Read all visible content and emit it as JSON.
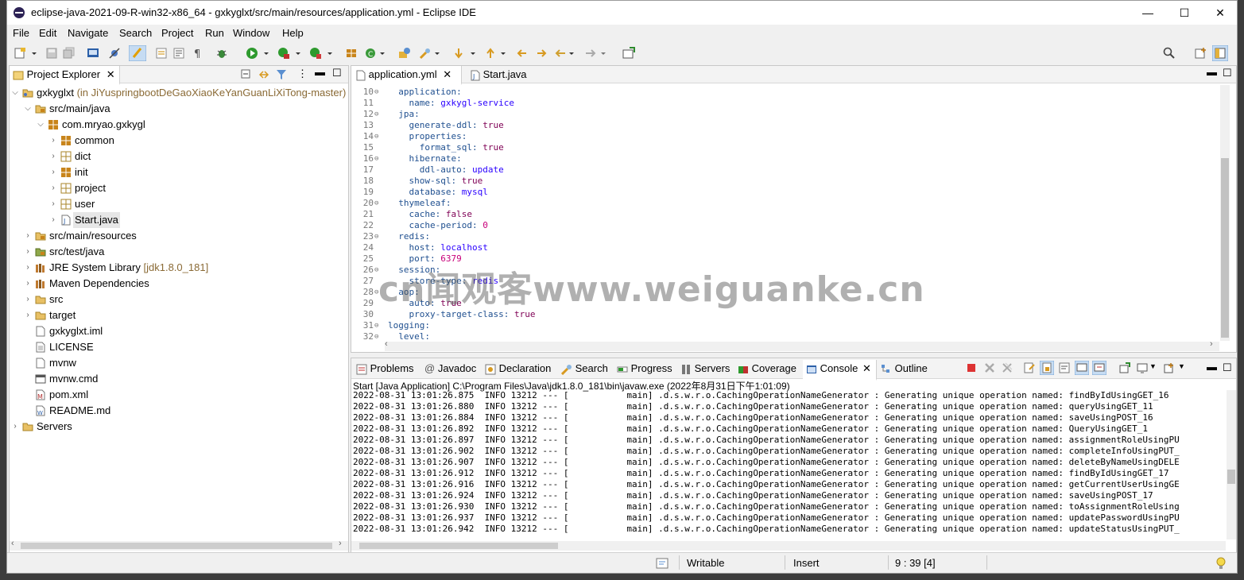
{
  "window": {
    "title": "eclipse-java-2021-09-R-win32-x86_64 - gxkyglxt/src/main/resources/application.yml - Eclipse IDE",
    "controls": {
      "minimize": "—",
      "maximize": "☐",
      "close": "✕"
    }
  },
  "menu": [
    "File",
    "Edit",
    "Navigate",
    "Search",
    "Project",
    "Run",
    "Window",
    "Help"
  ],
  "project_explorer": {
    "title": "Project Explorer",
    "project": {
      "name": "gxkyglxt",
      "decoration": "(in JiYuspringbootDeGaoXiaoKeYanGuanLiXiTong-master)"
    },
    "items": [
      {
        "label": "src/main/java",
        "decoration": ""
      },
      {
        "label": "com.mryao.gxkygl",
        "decoration": ""
      },
      {
        "label": "common",
        "decoration": ""
      },
      {
        "label": "dict",
        "decoration": ""
      },
      {
        "label": "init",
        "decoration": ""
      },
      {
        "label": "project",
        "decoration": ""
      },
      {
        "label": "user",
        "decoration": ""
      },
      {
        "label": "Start.java",
        "decoration": ""
      },
      {
        "label": "src/main/resources",
        "decoration": ""
      },
      {
        "label": "src/test/java",
        "decoration": ""
      },
      {
        "label": "JRE System Library",
        "decoration": "[jdk1.8.0_181]"
      },
      {
        "label": "Maven Dependencies",
        "decoration": ""
      },
      {
        "label": "src",
        "decoration": ""
      },
      {
        "label": "target",
        "decoration": ""
      },
      {
        "label": "gxkyglxt.iml",
        "decoration": ""
      },
      {
        "label": "LICENSE",
        "decoration": ""
      },
      {
        "label": "mvnw",
        "decoration": ""
      },
      {
        "label": "mvnw.cmd",
        "decoration": ""
      },
      {
        "label": "pom.xml",
        "decoration": ""
      },
      {
        "label": "README.md",
        "decoration": ""
      },
      {
        "label": "Servers",
        "decoration": ""
      }
    ]
  },
  "editor": {
    "tabs": [
      {
        "label": "application.yml",
        "close": "✕"
      },
      {
        "label": "Start.java",
        "close": ""
      }
    ],
    "lines": [
      {
        "num": "10",
        "fold": "⊖",
        "indent": "  ",
        "key": "application:",
        "value": "",
        "vtype": ""
      },
      {
        "num": "11",
        "fold": "",
        "indent": "    ",
        "key": "name:",
        "value": " gxkygl-service",
        "vtype": "s"
      },
      {
        "num": "12",
        "fold": "⊖",
        "indent": "  ",
        "key": "jpa:",
        "value": "",
        "vtype": ""
      },
      {
        "num": "13",
        "fold": "",
        "indent": "    ",
        "key": "generate-ddl:",
        "value": " true",
        "vtype": "b"
      },
      {
        "num": "14",
        "fold": "⊖",
        "indent": "    ",
        "key": "properties:",
        "value": "",
        "vtype": ""
      },
      {
        "num": "15",
        "fold": "",
        "indent": "      ",
        "key": "format_sql:",
        "value": " true",
        "vtype": "b"
      },
      {
        "num": "16",
        "fold": "⊖",
        "indent": "    ",
        "key": "hibernate:",
        "value": "",
        "vtype": ""
      },
      {
        "num": "17",
        "fold": "",
        "indent": "      ",
        "key": "ddl-auto:",
        "value": " update",
        "vtype": "s"
      },
      {
        "num": "18",
        "fold": "",
        "indent": "    ",
        "key": "show-sql:",
        "value": " true",
        "vtype": "b"
      },
      {
        "num": "19",
        "fold": "",
        "indent": "    ",
        "key": "database:",
        "value": " mysql",
        "vtype": "s"
      },
      {
        "num": "20",
        "fold": "⊖",
        "indent": "  ",
        "key": "thymeleaf:",
        "value": "",
        "vtype": ""
      },
      {
        "num": "21",
        "fold": "",
        "indent": "    ",
        "key": "cache:",
        "value": " false",
        "vtype": "b"
      },
      {
        "num": "22",
        "fold": "",
        "indent": "    ",
        "key": "cache-period:",
        "value": " 0",
        "vtype": "n"
      },
      {
        "num": "23",
        "fold": "⊖",
        "indent": "  ",
        "key": "redis:",
        "value": "",
        "vtype": ""
      },
      {
        "num": "24",
        "fold": "",
        "indent": "    ",
        "key": "host:",
        "value": " localhost",
        "vtype": "s"
      },
      {
        "num": "25",
        "fold": "",
        "indent": "    ",
        "key": "port:",
        "value": " 6379",
        "vtype": "n"
      },
      {
        "num": "26",
        "fold": "⊖",
        "indent": "  ",
        "key": "session:",
        "value": "",
        "vtype": ""
      },
      {
        "num": "27",
        "fold": "",
        "indent": "    ",
        "key": "store-type:",
        "value": " redis",
        "vtype": "s"
      },
      {
        "num": "28",
        "fold": "⊖",
        "indent": "  ",
        "key": "aop:",
        "value": "",
        "vtype": ""
      },
      {
        "num": "29",
        "fold": "",
        "indent": "    ",
        "key": "auto:",
        "value": " true",
        "vtype": "b"
      },
      {
        "num": "30",
        "fold": "",
        "indent": "    ",
        "key": "proxy-target-class:",
        "value": " true",
        "vtype": "b"
      },
      {
        "num": "31",
        "fold": "⊖",
        "indent": "",
        "key": "logging:",
        "value": "",
        "vtype": ""
      },
      {
        "num": "32",
        "fold": "⊖",
        "indent": "  ",
        "key": "level:",
        "value": "",
        "vtype": ""
      }
    ]
  },
  "bottom_tabs": [
    "Problems",
    "Javadoc",
    "Declaration",
    "Search",
    "Progress",
    "Servers",
    "Coverage",
    "Console",
    "Outline"
  ],
  "console": {
    "header": "Start [Java Application] C:\\Program Files\\Java\\jdk1.8.0_181\\bin\\javaw.exe  (2022年8月31日下午1:01:09)",
    "lines": [
      "2022-08-31 13:01:26.875  INFO 13212 --- [           main] .d.s.w.r.o.CachingOperationNameGenerator : Generating unique operation named: findByIdUsingGET_16",
      "2022-08-31 13:01:26.880  INFO 13212 --- [           main] .d.s.w.r.o.CachingOperationNameGenerator : Generating unique operation named: queryUsingGET_11",
      "2022-08-31 13:01:26.884  INFO 13212 --- [           main] .d.s.w.r.o.CachingOperationNameGenerator : Generating unique operation named: saveUsingPOST_16",
      "2022-08-31 13:01:26.892  INFO 13212 --- [           main] .d.s.w.r.o.CachingOperationNameGenerator : Generating unique operation named: QueryUsingGET_1",
      "2022-08-31 13:01:26.897  INFO 13212 --- [           main] .d.s.w.r.o.CachingOperationNameGenerator : Generating unique operation named: assignmentRoleUsingPU",
      "2022-08-31 13:01:26.902  INFO 13212 --- [           main] .d.s.w.r.o.CachingOperationNameGenerator : Generating unique operation named: completeInfoUsingPUT_",
      "2022-08-31 13:01:26.907  INFO 13212 --- [           main] .d.s.w.r.o.CachingOperationNameGenerator : Generating unique operation named: deleteByNameUsingDELE",
      "2022-08-31 13:01:26.912  INFO 13212 --- [           main] .d.s.w.r.o.CachingOperationNameGenerator : Generating unique operation named: findByIdUsingGET_17",
      "2022-08-31 13:01:26.916  INFO 13212 --- [           main] .d.s.w.r.o.CachingOperationNameGenerator : Generating unique operation named: getCurrentUserUsingGE",
      "2022-08-31 13:01:26.924  INFO 13212 --- [           main] .d.s.w.r.o.CachingOperationNameGenerator : Generating unique operation named: saveUsingPOST_17",
      "2022-08-31 13:01:26.930  INFO 13212 --- [           main] .d.s.w.r.o.CachingOperationNameGenerator : Generating unique operation named: toAssignmentRoleUsing",
      "2022-08-31 13:01:26.937  INFO 13212 --- [           main] .d.s.w.r.o.CachingOperationNameGenerator : Generating unique operation named: updatePasswordUsingPU",
      "2022-08-31 13:01:26.942  INFO 13212 --- [           main] .d.s.w.r.o.CachingOperationNameGenerator : Generating unique operation named: updateStatusUsingPUT_"
    ]
  },
  "status": {
    "writable": "Writable",
    "insert": "Insert",
    "position": "9 : 39 [4]"
  },
  "watermark": "cn闻观客www.weiguanke.cn",
  "colors": {
    "key": "#205090",
    "string": "#2a00ff",
    "boolean": "#7f0055",
    "number": "#c8007a"
  }
}
